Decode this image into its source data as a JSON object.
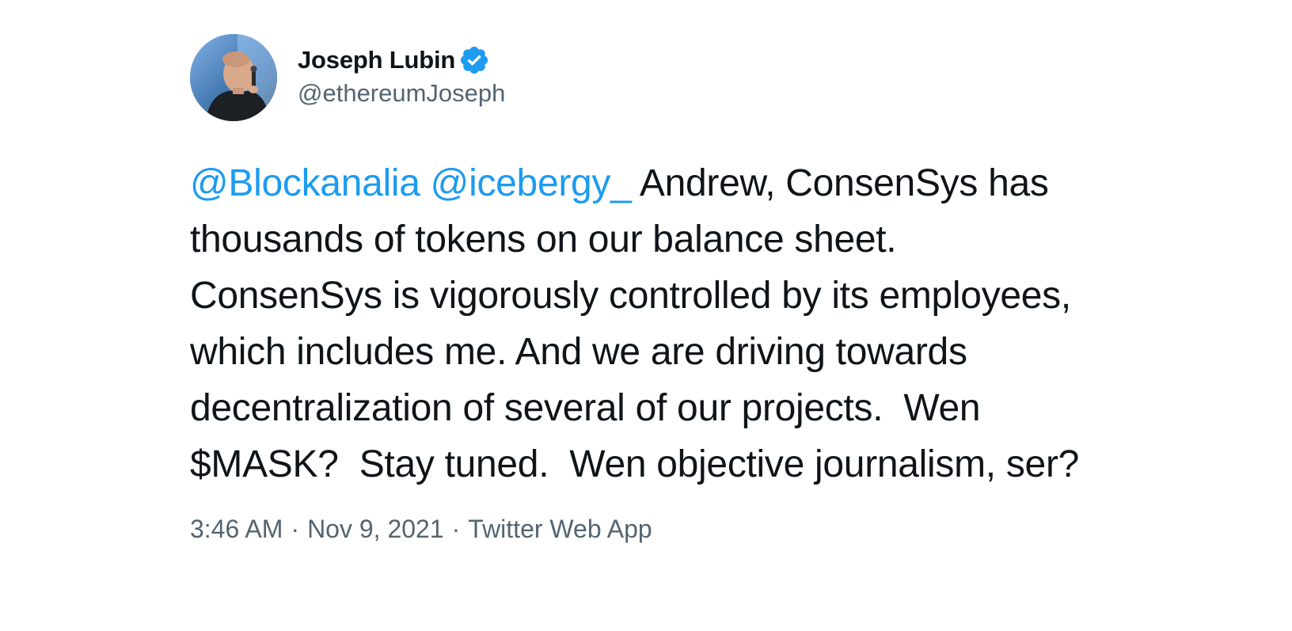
{
  "author": {
    "display_name": "Joseph Lubin",
    "handle": "@ethereumJoseph",
    "verified_icon": "verified-badge-icon",
    "avatar_icon": "avatar-photo"
  },
  "tweet": {
    "mentions": [
      "@Blockanalia",
      "@icebergy_"
    ],
    "body": " Andrew, ConsenSys has thousands of tokens on our balance sheet. ConsenSys is vigorously controlled by its employees, which includes me. And we are driving towards decentralization of several of our projects.  Wen $MASK?  Stay tuned.  Wen objective journalism, ser?"
  },
  "meta": {
    "time": "3:46 AM",
    "separator": "·",
    "date": "Nov 9, 2021",
    "source": "Twitter Web App"
  },
  "colors": {
    "link": "#1d9bf0",
    "secondary_text": "#536471",
    "primary_text": "#0f1419",
    "verified": "#1d9bf0"
  }
}
